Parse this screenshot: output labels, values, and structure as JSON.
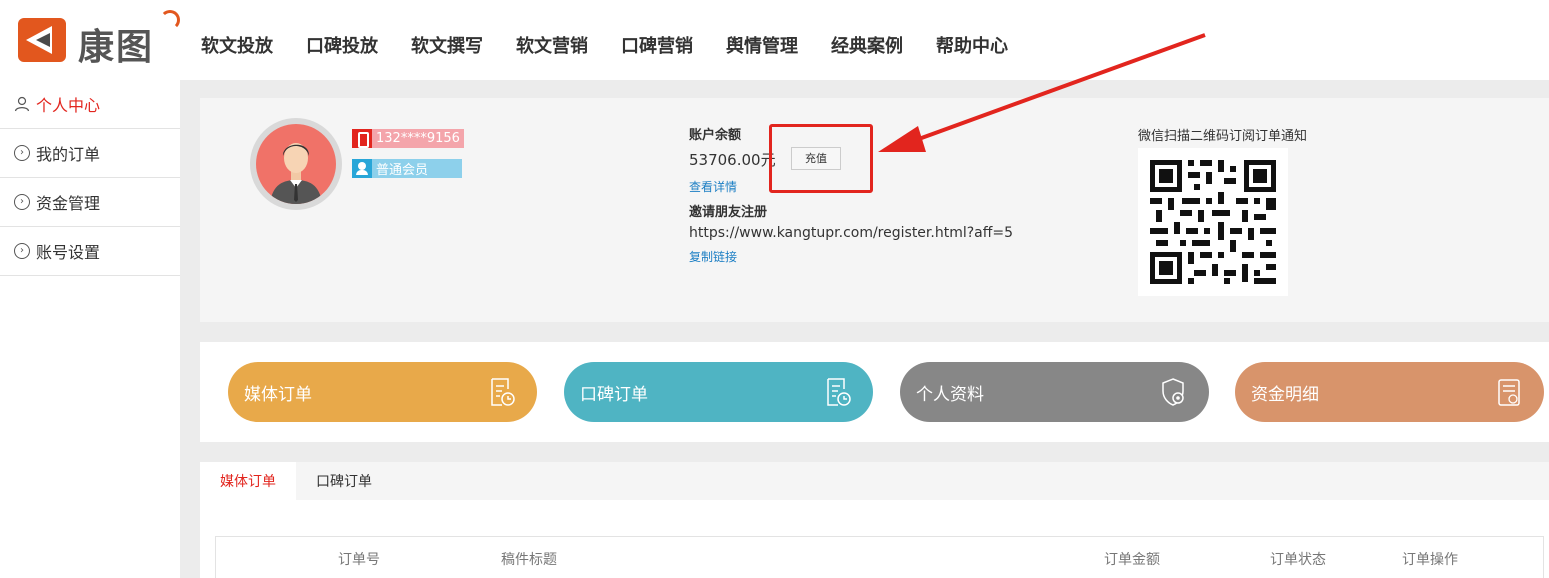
{
  "brand": {
    "logo_text": "康图"
  },
  "nav": [
    "软文投放",
    "口碑投放",
    "软文撰写",
    "软文营销",
    "口碑营销",
    "舆情管理",
    "经典案例",
    "帮助中心"
  ],
  "sidebar": {
    "items": [
      {
        "label": "个人中心",
        "icon": "user-icon"
      },
      {
        "label": "我的订单",
        "icon": "chevron-right-circle-icon"
      },
      {
        "label": "资金管理",
        "icon": "chevron-right-circle-icon"
      },
      {
        "label": "账号设置",
        "icon": "chevron-right-circle-icon"
      }
    ]
  },
  "profile": {
    "phone": "132****9156",
    "member_level": "普通会员",
    "balance_label": "账户余额",
    "balance_value": "53706.00元",
    "recharge_label": "充值",
    "detail_link": "查看详情",
    "invite_label": "邀请朋友注册",
    "invite_url": "https://www.kangtupr.com/register.html?aff=5",
    "copy_link": "复制链接",
    "qr_label": "微信扫描二维码订阅订单通知"
  },
  "quick_buttons": [
    {
      "label": "媒体订单",
      "icon": "order-clock-icon",
      "color": "#e8a94a"
    },
    {
      "label": "口碑订单",
      "icon": "order-clock-icon",
      "color": "#4fb4c3"
    },
    {
      "label": "个人资料",
      "icon": "shield-gear-icon",
      "color": "#878787"
    },
    {
      "label": "资金明细",
      "icon": "money-list-icon",
      "color": "#d8946b"
    }
  ],
  "orders": {
    "tabs": [
      "媒体订单",
      "口碑订单"
    ],
    "columns": [
      "订单号",
      "稿件标题",
      "订单金额",
      "订单状态",
      "订单操作"
    ]
  },
  "colors": {
    "accent": "#e2251e",
    "link": "#1d7fc4"
  }
}
